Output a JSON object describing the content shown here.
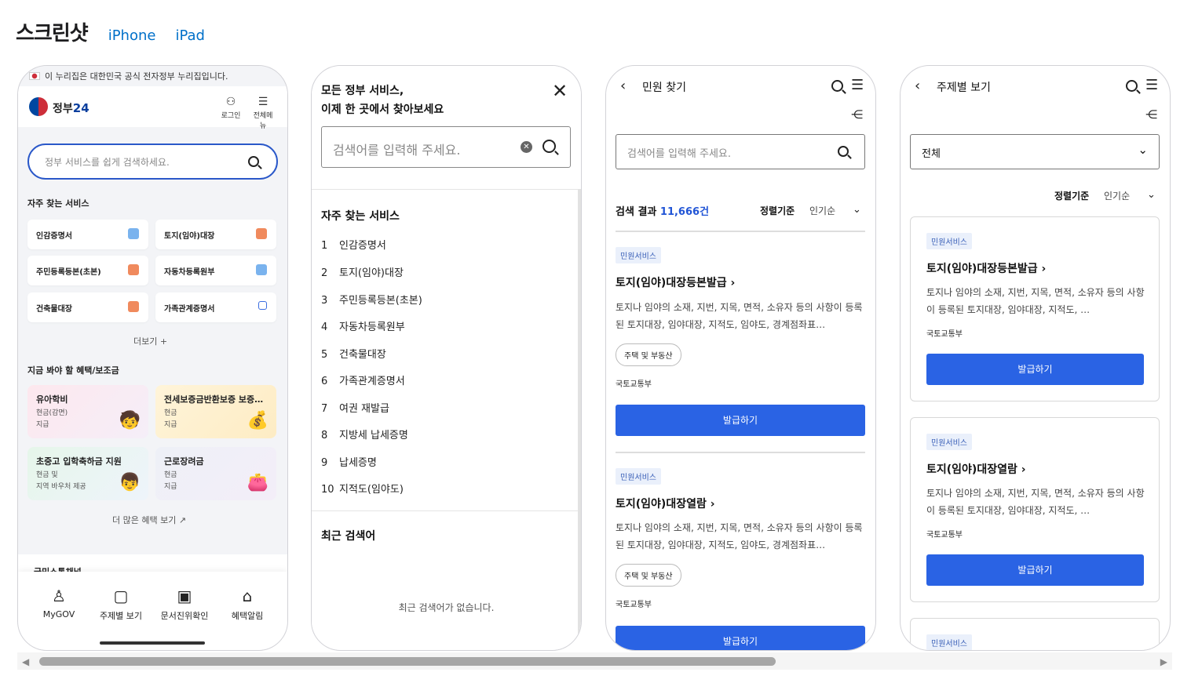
{
  "header": {
    "title": "스크린샷",
    "tabs": [
      "iPhone",
      "iPad"
    ]
  },
  "s1": {
    "gov_notice": "이 누리집은 대한민국 공식 전자정부 누리집입니다.",
    "logo_text": "정부",
    "logo_num": "24",
    "login": "로그인",
    "menu": "전체메뉴",
    "search_placeholder": "정부 서비스를 쉽게 검색하세요.",
    "frequent_title": "자주 찾는 서비스",
    "services": [
      "인감증명서",
      "토지(임야)대장",
      "주민등록등본(초본)",
      "자동차등록원부",
      "건축물대장",
      "가족관계증명서"
    ],
    "more": "더보기 +",
    "benefits_title": "지금 봐야 할 혜택/보조금",
    "benefits": [
      {
        "title": "유아학비",
        "d1": "현금(감면)",
        "d2": "지급"
      },
      {
        "title": "전세보증금반환보증 보증…",
        "d1": "현금",
        "d2": "지급"
      },
      {
        "title": "초중고 입학축하금 지원",
        "d1": "현금 및",
        "d2": "지역 바우처 제공"
      },
      {
        "title": "근로장려금",
        "d1": "현금",
        "d2": "지급"
      }
    ],
    "more_benefits": "더 많은 혜택 보기 ↗",
    "channel": "국민소통채널",
    "nav": [
      "MyGOV",
      "주제별 보기",
      "문서진위확인",
      "혜택알림"
    ]
  },
  "s2": {
    "title1": "모든 정부 서비스,",
    "title2": "이제 한 곳에서 찾아보세요",
    "input_placeholder": "검색어를 입력해 주세요.",
    "frequent_title": "자주 찾는 서비스",
    "items": [
      "인감증명서",
      "토지(임야)대장",
      "주민등록등본(초본)",
      "자동차등록원부",
      "건축물대장",
      "가족관계증명서",
      "여권 재발급",
      "지방세 납세증명",
      "납세증명",
      "지적도(임야도)"
    ],
    "numbers": [
      "1",
      "2",
      "3",
      "4",
      "5",
      "6",
      "7",
      "8",
      "9",
      "10"
    ],
    "recent_title": "최근 검색어",
    "recent_empty": "최근 검색어가 없습니다."
  },
  "s3": {
    "title": "민원 찾기",
    "input_placeholder": "검색어를 입력해 주세요.",
    "result_prefix": "검색 결과",
    "result_count": "11,666건",
    "sort_label": "정렬기준",
    "sort_value": "인기순",
    "cards": [
      {
        "badge": "민원서비스",
        "title": "토지(임야)대장등본발급 ›",
        "desc": "토지나 임야의 소재, 지번, 지목, 면적, 소유자 등의 사항이 등록된 토지대장, 임야대장, 지적도, 임야도, 경계점좌표…",
        "tag": "주택 및 부동산",
        "agency": "국토교통부",
        "button": "발급하기"
      },
      {
        "badge": "민원서비스",
        "title": "토지(임야)대장열람 ›",
        "desc": "토지나 임야의 소재, 지번, 지목, 면적, 소유자 등의 사항이 등록된 토지대장, 임야대장, 지적도, 임야도, 경계점좌표…",
        "tag": "주택 및 부동산",
        "agency": "국토교통부",
        "button": "발급하기"
      }
    ]
  },
  "s4": {
    "title": "주제별 보기",
    "select_value": "전체",
    "sort_label": "정렬기준",
    "sort_value": "인기순",
    "cards": [
      {
        "badge": "민원서비스",
        "title": "토지(임야)대장등본발급 ›",
        "desc": "토지나 임야의 소재, 지번, 지목, 면적, 소유자 등의 사항이 등록된 토지대장, 임야대장, 지적도, …",
        "agency": "국토교통부",
        "button": "발급하기"
      },
      {
        "badge": "민원서비스",
        "title": "토지(임야)대장열람 ›",
        "desc": "토지나 임야의 소재, 지번, 지목, 면적, 소유자 등의 사항이 등록된 토지대장, 임야대장, 지적도, …",
        "agency": "국토교통부",
        "button": "발급하기"
      },
      {
        "badge": "민원서비스"
      }
    ]
  }
}
